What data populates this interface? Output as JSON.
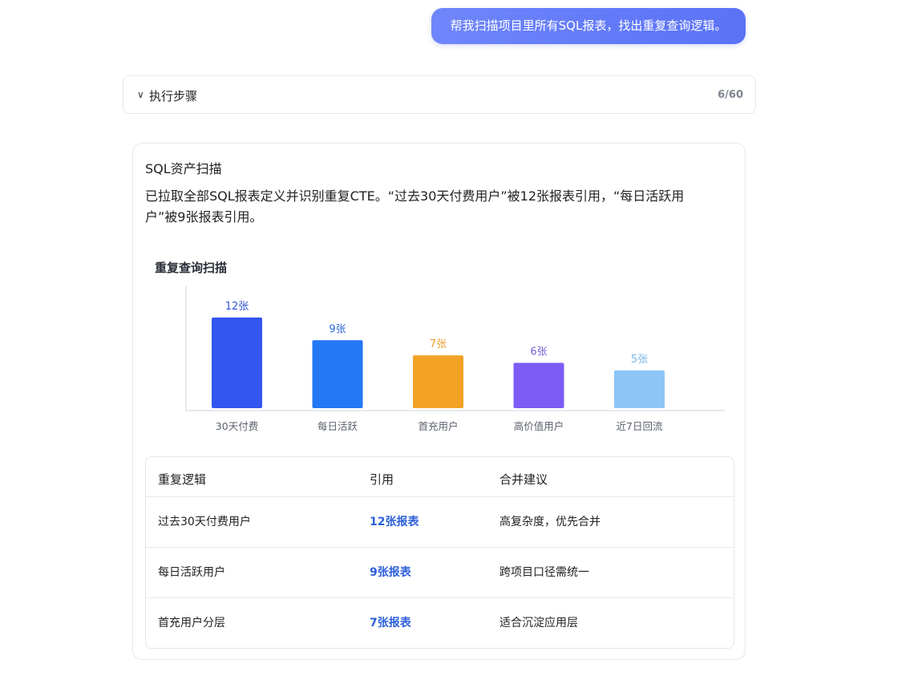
{
  "user_message": "帮我扫描项目里所有SQL报表，找出重复查询逻辑。",
  "steps": {
    "label": "执行步骤",
    "count": "6/60"
  },
  "card": {
    "title": "SQL资产扫描",
    "description": "已拉取全部SQL报表定义并识别重复CTE。“过去30天付费用户”被12张报表引用，“每日活跃用户”被9张报表引用。"
  },
  "chart_data": {
    "type": "bar",
    "title": "重复查询扫描",
    "categories": [
      "30天付费",
      "每日活跃",
      "首充用户",
      "高价值用户",
      "近7日回流"
    ],
    "values": [
      12,
      9,
      7,
      6,
      5
    ],
    "value_labels": [
      "12张",
      "9张",
      "7张",
      "6张",
      "5张"
    ],
    "colors": [
      "#3355f0",
      "#2478f5",
      "#f2a325",
      "#7c5cf5",
      "#8ec5f7"
    ],
    "label_colors": [
      "#2d55d6",
      "#2d6bd6",
      "#e8a030",
      "#7b62d8",
      "#7ab6e8"
    ],
    "ylim": [
      0,
      14
    ],
    "grid": false
  },
  "table": {
    "headers": [
      "重复逻辑",
      "引用",
      "合并建议"
    ],
    "rows": [
      {
        "logic": "过去30天付费用户",
        "refs": "12张报表",
        "advice": "高复杂度，优先合并"
      },
      {
        "logic": "每日活跃用户",
        "refs": "9张报表",
        "advice": "跨项目口径需统一"
      },
      {
        "logic": "首充用户分层",
        "refs": "7张报表",
        "advice": "适合沉淀应用层"
      }
    ]
  }
}
